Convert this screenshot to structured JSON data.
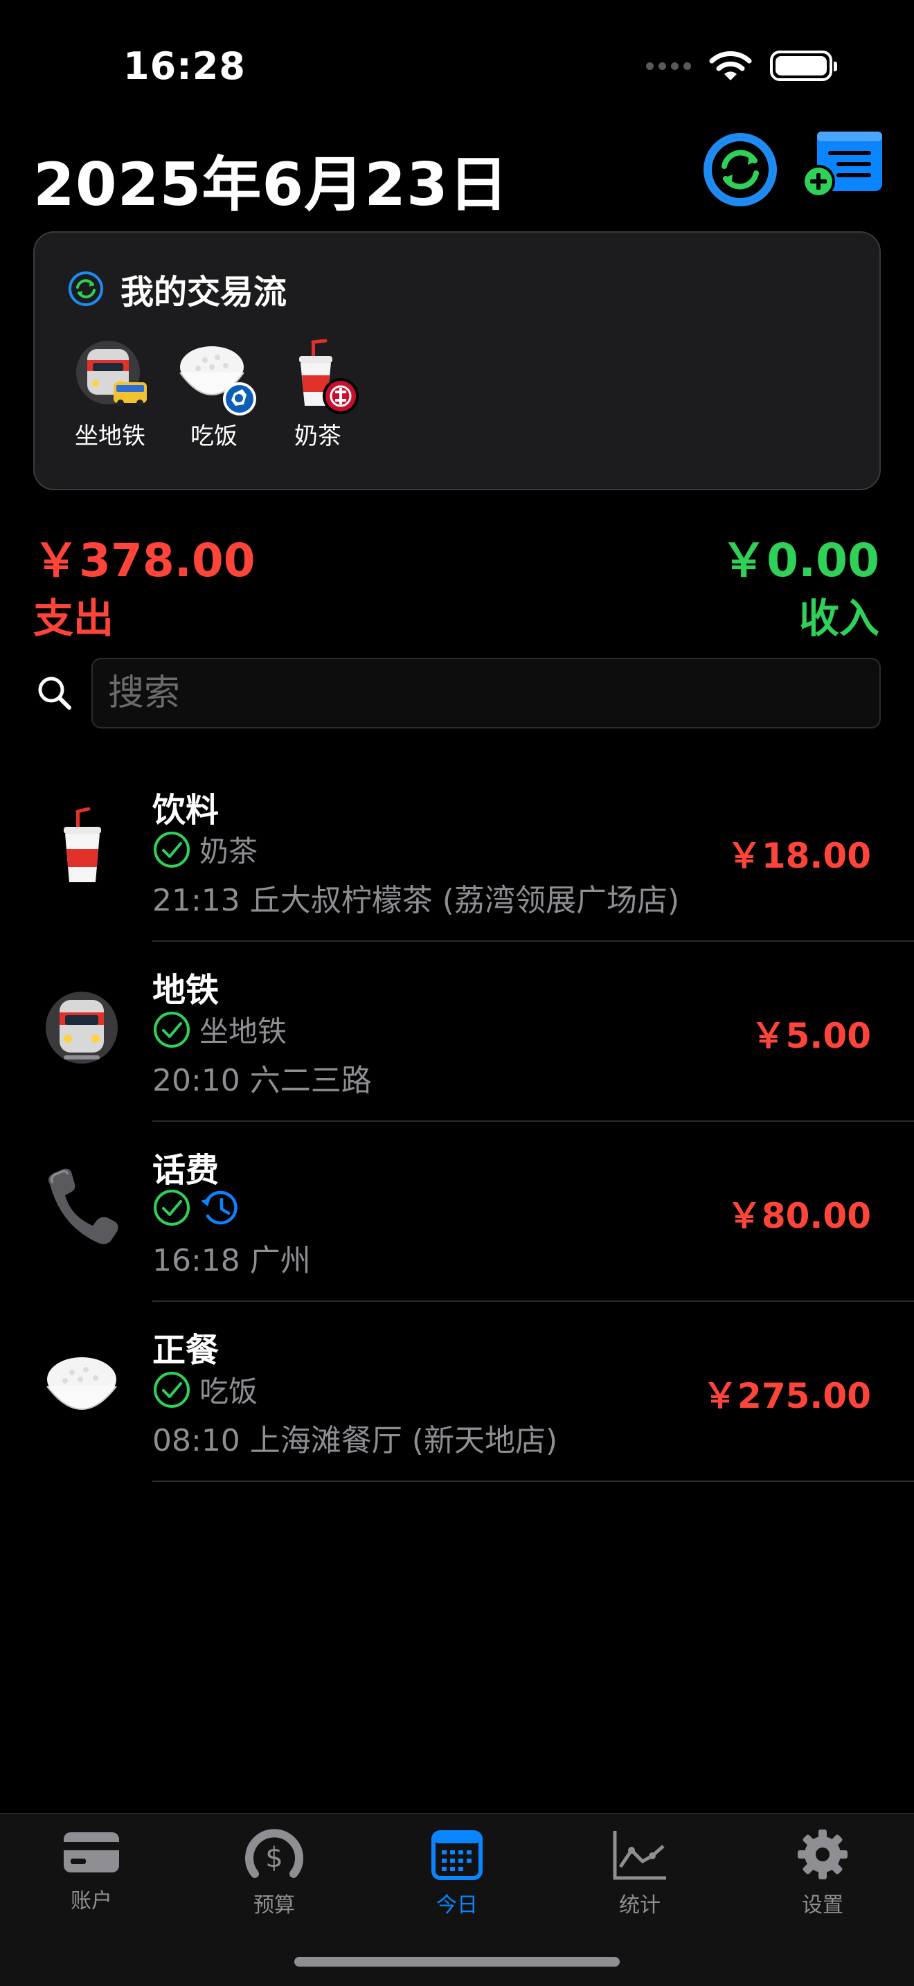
{
  "status_bar": {
    "time": "16:28"
  },
  "header": {
    "title": "2025年6月23日",
    "sync_button_icon": "sync-icon",
    "add_button_icon": "add-list-icon"
  },
  "flow_card": {
    "title": "我的交易流",
    "items": [
      {
        "label": "坐地铁",
        "icon": "subway-bus-icon"
      },
      {
        "label": "吃饭",
        "icon": "rice-bowl-icon"
      },
      {
        "label": "奶茶",
        "icon": "drink-cup-icon"
      }
    ]
  },
  "summary": {
    "expense_amount": "￥378.00",
    "expense_label": "支出",
    "income_amount": "￥0.00",
    "income_label": "收入"
  },
  "search": {
    "placeholder": "搜索"
  },
  "transactions": [
    {
      "category": "饮料",
      "tag": "奶茶",
      "detail": "21:13 丘大叔柠檬茶 (荔湾领展广场店)",
      "amount": "￥18.00",
      "icon": "drink-cup-icon"
    },
    {
      "category": "地铁",
      "tag": "坐地铁",
      "detail": "20:10 六二三路",
      "amount": "￥5.00",
      "icon": "subway-icon"
    },
    {
      "category": "话费",
      "tag": "",
      "detail": "16:18 广州",
      "amount": "￥80.00",
      "icon": "telephone-icon"
    },
    {
      "category": "正餐",
      "tag": "吃饭",
      "detail": "08:10 上海滩餐厅 (新天地店)",
      "amount": "￥275.00",
      "icon": "rice-bowl-icon"
    }
  ],
  "tab_bar": {
    "tabs": [
      {
        "label": "账户",
        "icon": "card-icon"
      },
      {
        "label": "预算",
        "icon": "budget-gauge-icon"
      },
      {
        "label": "今日",
        "icon": "calendar-icon"
      },
      {
        "label": "统计",
        "icon": "chart-icon"
      },
      {
        "label": "设置",
        "icon": "gear-icon"
      }
    ],
    "active": "今日"
  },
  "colors": {
    "expense": "#ff453a",
    "income": "#30d158",
    "accent": "#0a84ff"
  }
}
